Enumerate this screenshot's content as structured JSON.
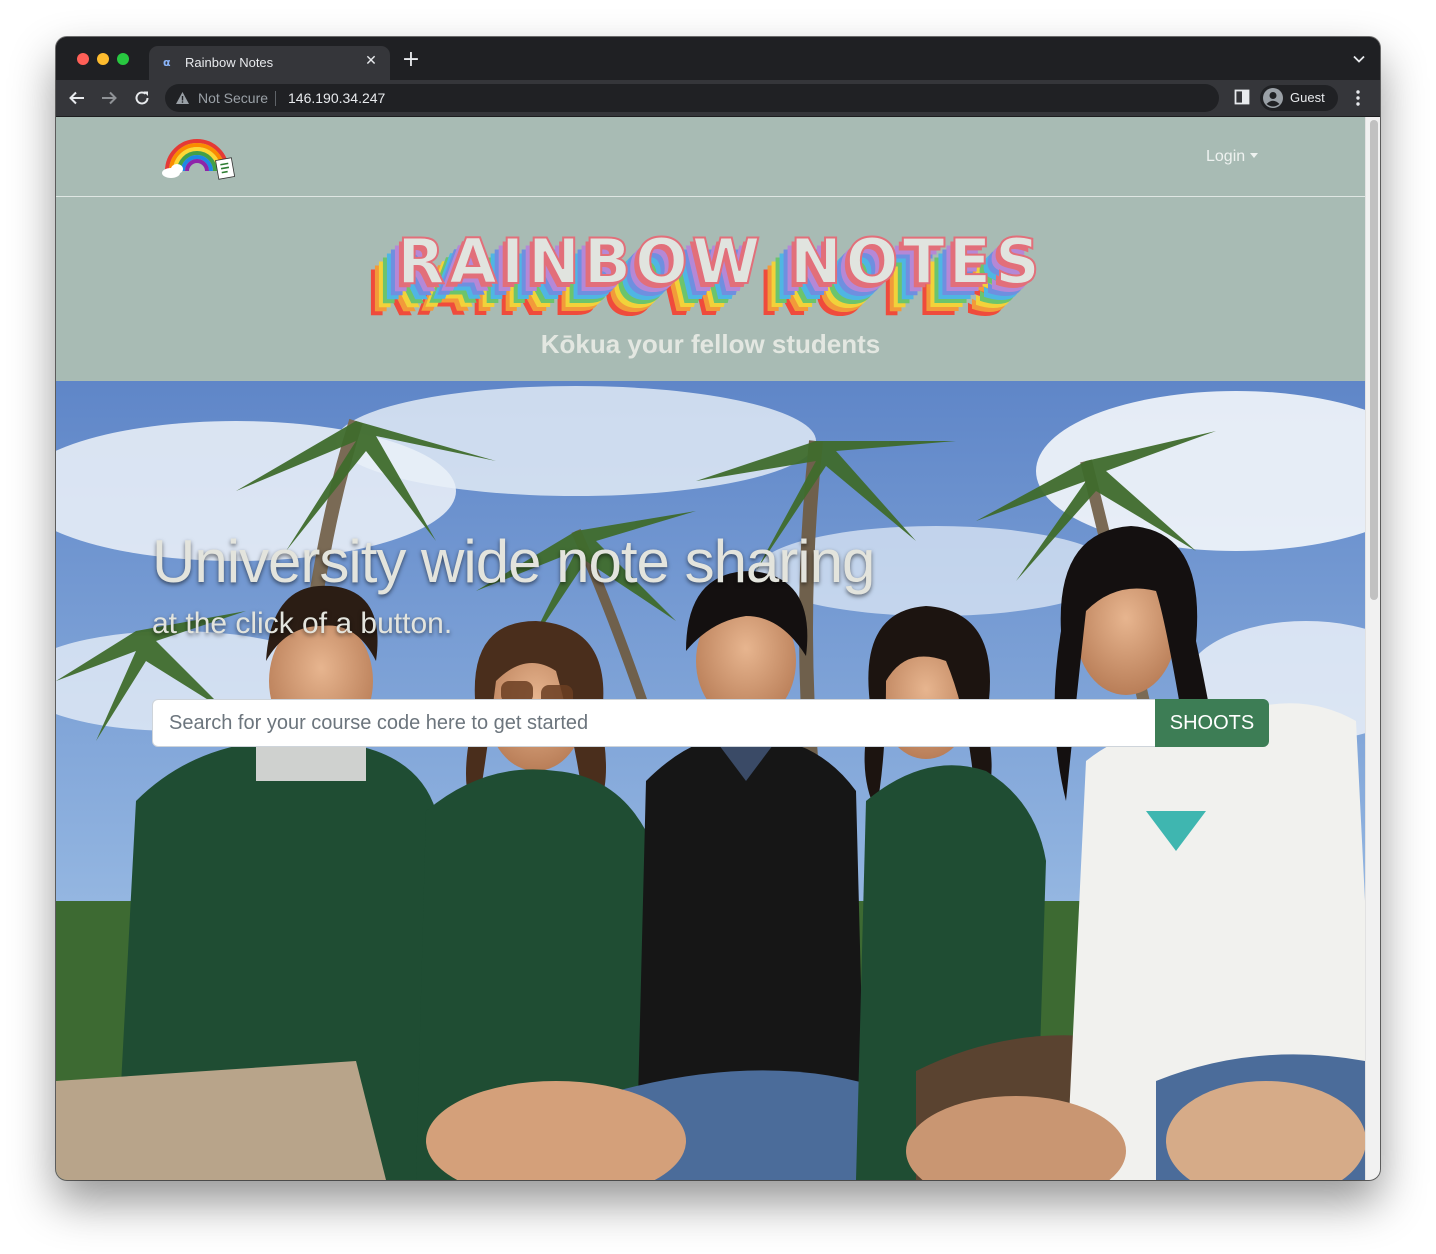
{
  "browser": {
    "tab": {
      "title": "Rainbow Notes",
      "close_glyph": "✕",
      "favicon_glyph": "α"
    },
    "new_tab_glyph": "+",
    "omnibox": {
      "security_label": "Not Secure",
      "url": "146.190.34.247"
    },
    "profile": {
      "label": "Guest"
    }
  },
  "navbar": {
    "login_label": "Login"
  },
  "hero": {
    "title": "RAINBOW NOTES",
    "subtitle": "Kōkua your fellow students",
    "headline": "University wide note sharing",
    "subline": "at the click of a button.",
    "search": {
      "placeholder": "Search for your course code here to get started",
      "value": ""
    },
    "search_button_label": "SHOOTS"
  },
  "colors": {
    "page_bg": "#a8bbb4",
    "button_green": "#3d7d55",
    "title_fill": "#e1e4df",
    "rainbow": [
      "#e26f7a",
      "#b588d6",
      "#6f8fe0",
      "#4fb6e3",
      "#6cc46c",
      "#f2d23a",
      "#f29a3a",
      "#ef4b3c"
    ]
  },
  "icons": {
    "back": "back-arrow-icon",
    "forward": "forward-arrow-icon",
    "reload": "reload-icon",
    "warning": "warning-icon",
    "side_panel": "side-panel-icon",
    "profile": "profile-avatar-icon",
    "menu": "kebab-menu-icon",
    "logo": "rainbow-logo-icon"
  }
}
